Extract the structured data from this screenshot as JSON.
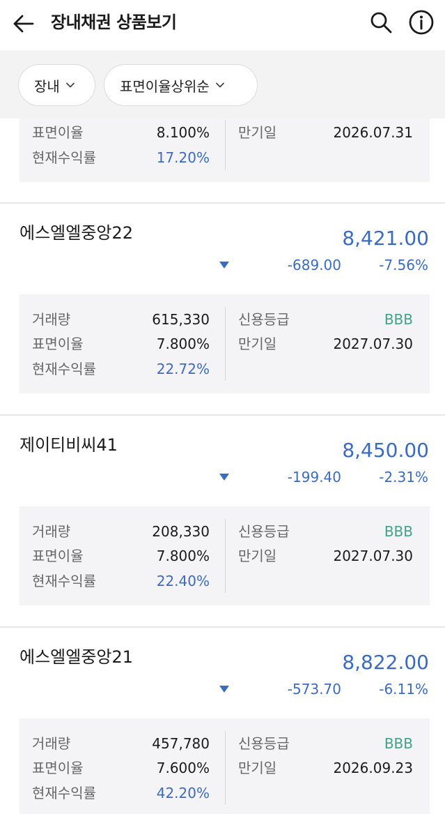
{
  "header": {
    "title": "장내채권 상품보기",
    "back_icon": "arrow-left-icon",
    "search_icon": "search-icon",
    "info_icon": "info-icon"
  },
  "filters": [
    {
      "label": "장내"
    },
    {
      "label": "표면이율상위순"
    }
  ],
  "partial_item": {
    "coupon_label": "표면이율",
    "coupon": "8.100%",
    "yield_label": "현재수익률",
    "yield": "17.20%",
    "maturity_label": "만기일",
    "maturity": "2026.07.31"
  },
  "items": [
    {
      "name": "에스엘엘중앙22",
      "price": "8,421.00",
      "change": "-689.00",
      "change_pct": "-7.56%",
      "volume_label": "거래량",
      "volume": "615,330",
      "coupon_label": "표면이율",
      "coupon": "7.800%",
      "yield_label": "현재수익률",
      "yield": "22.72%",
      "rating_label": "신용등급",
      "rating": "BBB",
      "maturity_label": "만기일",
      "maturity": "2027.07.30"
    },
    {
      "name": "제이티비씨41",
      "price": "8,450.00",
      "change": "-199.40",
      "change_pct": "-2.31%",
      "volume_label": "거래량",
      "volume": "208,330",
      "coupon_label": "표면이율",
      "coupon": "7.800%",
      "yield_label": "현재수익률",
      "yield": "22.40%",
      "rating_label": "신용등급",
      "rating": "BBB",
      "maturity_label": "만기일",
      "maturity": "2027.07.30"
    },
    {
      "name": "에스엘엘중앙21",
      "price": "8,822.00",
      "change": "-573.70",
      "change_pct": "-6.11%",
      "volume_label": "거래량",
      "volume": "457,780",
      "coupon_label": "표면이율",
      "coupon": "7.600%",
      "yield_label": "현재수익률",
      "yield": "42.20%",
      "rating_label": "신용등급",
      "rating": "BBB",
      "maturity_label": "만기일",
      "maturity": "2026.09.23"
    }
  ],
  "colors": {
    "accent_blue": "#3a6bc4",
    "rating_green": "#3fa38a",
    "box_bg": "#f4f4f6",
    "filter_bg": "#f3f3f4"
  }
}
